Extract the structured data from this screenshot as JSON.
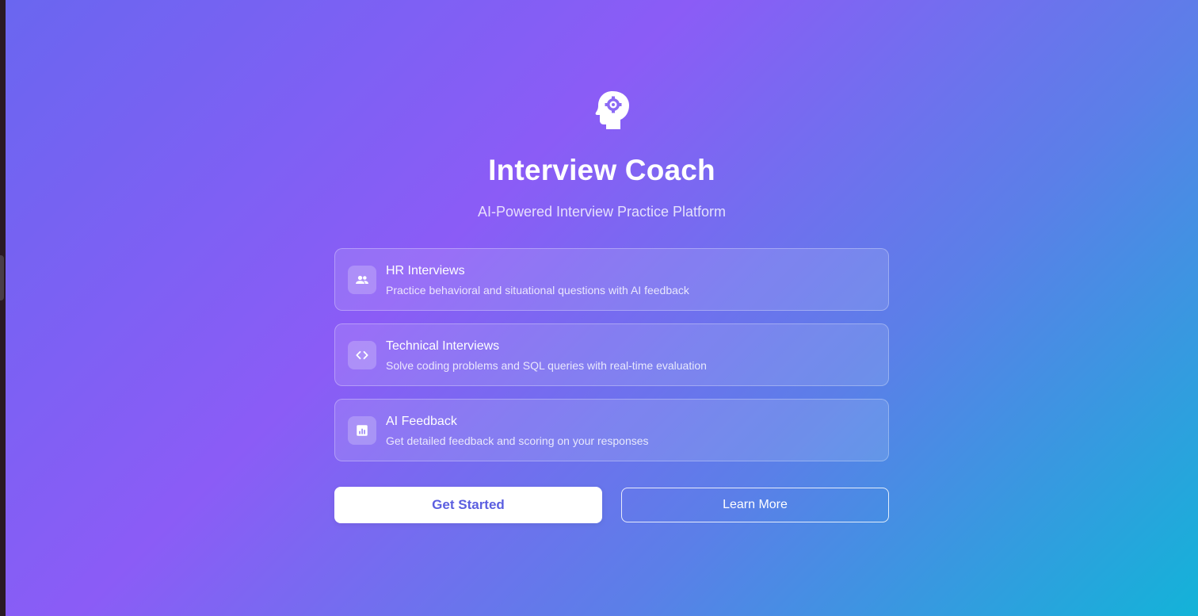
{
  "app": {
    "title": "Interview Coach",
    "subtitle": "AI-Powered Interview Practice Platform",
    "logo_icon": "psychology-head-gear-icon"
  },
  "features": [
    {
      "icon": "people-icon",
      "title": "HR Interviews",
      "description": "Practice behavioral and situational questions with AI feedback"
    },
    {
      "icon": "code-icon",
      "title": "Technical Interviews",
      "description": "Solve coding problems and SQL queries with real-time evaluation"
    },
    {
      "icon": "analytics-icon",
      "title": "AI Feedback",
      "description": "Get detailed feedback and scoring on your responses"
    }
  ],
  "actions": {
    "primary_label": "Get Started",
    "secondary_label": "Learn More"
  },
  "colors": {
    "gradient_start": "#6a66f0",
    "gradient_mid": "#8b5cf6",
    "gradient_end": "#13b3d8",
    "primary_button_text": "#5b5ee0"
  }
}
